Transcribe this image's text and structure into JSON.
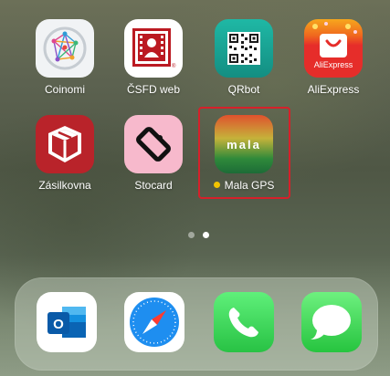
{
  "home_screen": {
    "apps": [
      {
        "label": "Coinomi",
        "icon": "coinomi-icon"
      },
      {
        "label": "ČSFD web",
        "icon": "csfd-icon"
      },
      {
        "label": "QRbot",
        "icon": "qrbot-icon"
      },
      {
        "label": "AliExpress",
        "icon": "aliexpress-icon",
        "icon_text": "AliExpress"
      },
      {
        "label": "Zásilkovna",
        "icon": "zasilkovna-icon"
      },
      {
        "label": "Stocard",
        "icon": "stocard-icon"
      },
      {
        "label": "Mala GPS",
        "icon": "mala-gps-icon",
        "icon_text": "mala",
        "new_indicator": true
      }
    ],
    "page_indicator": {
      "pages": 2,
      "current": 2
    },
    "highlight_color": "#d6202a"
  },
  "dock": {
    "apps": [
      {
        "name": "Outlook",
        "icon": "outlook-icon"
      },
      {
        "name": "Safari",
        "icon": "safari-icon"
      },
      {
        "name": "Phone",
        "icon": "phone-icon"
      },
      {
        "name": "Messages",
        "icon": "messages-icon"
      }
    ]
  }
}
